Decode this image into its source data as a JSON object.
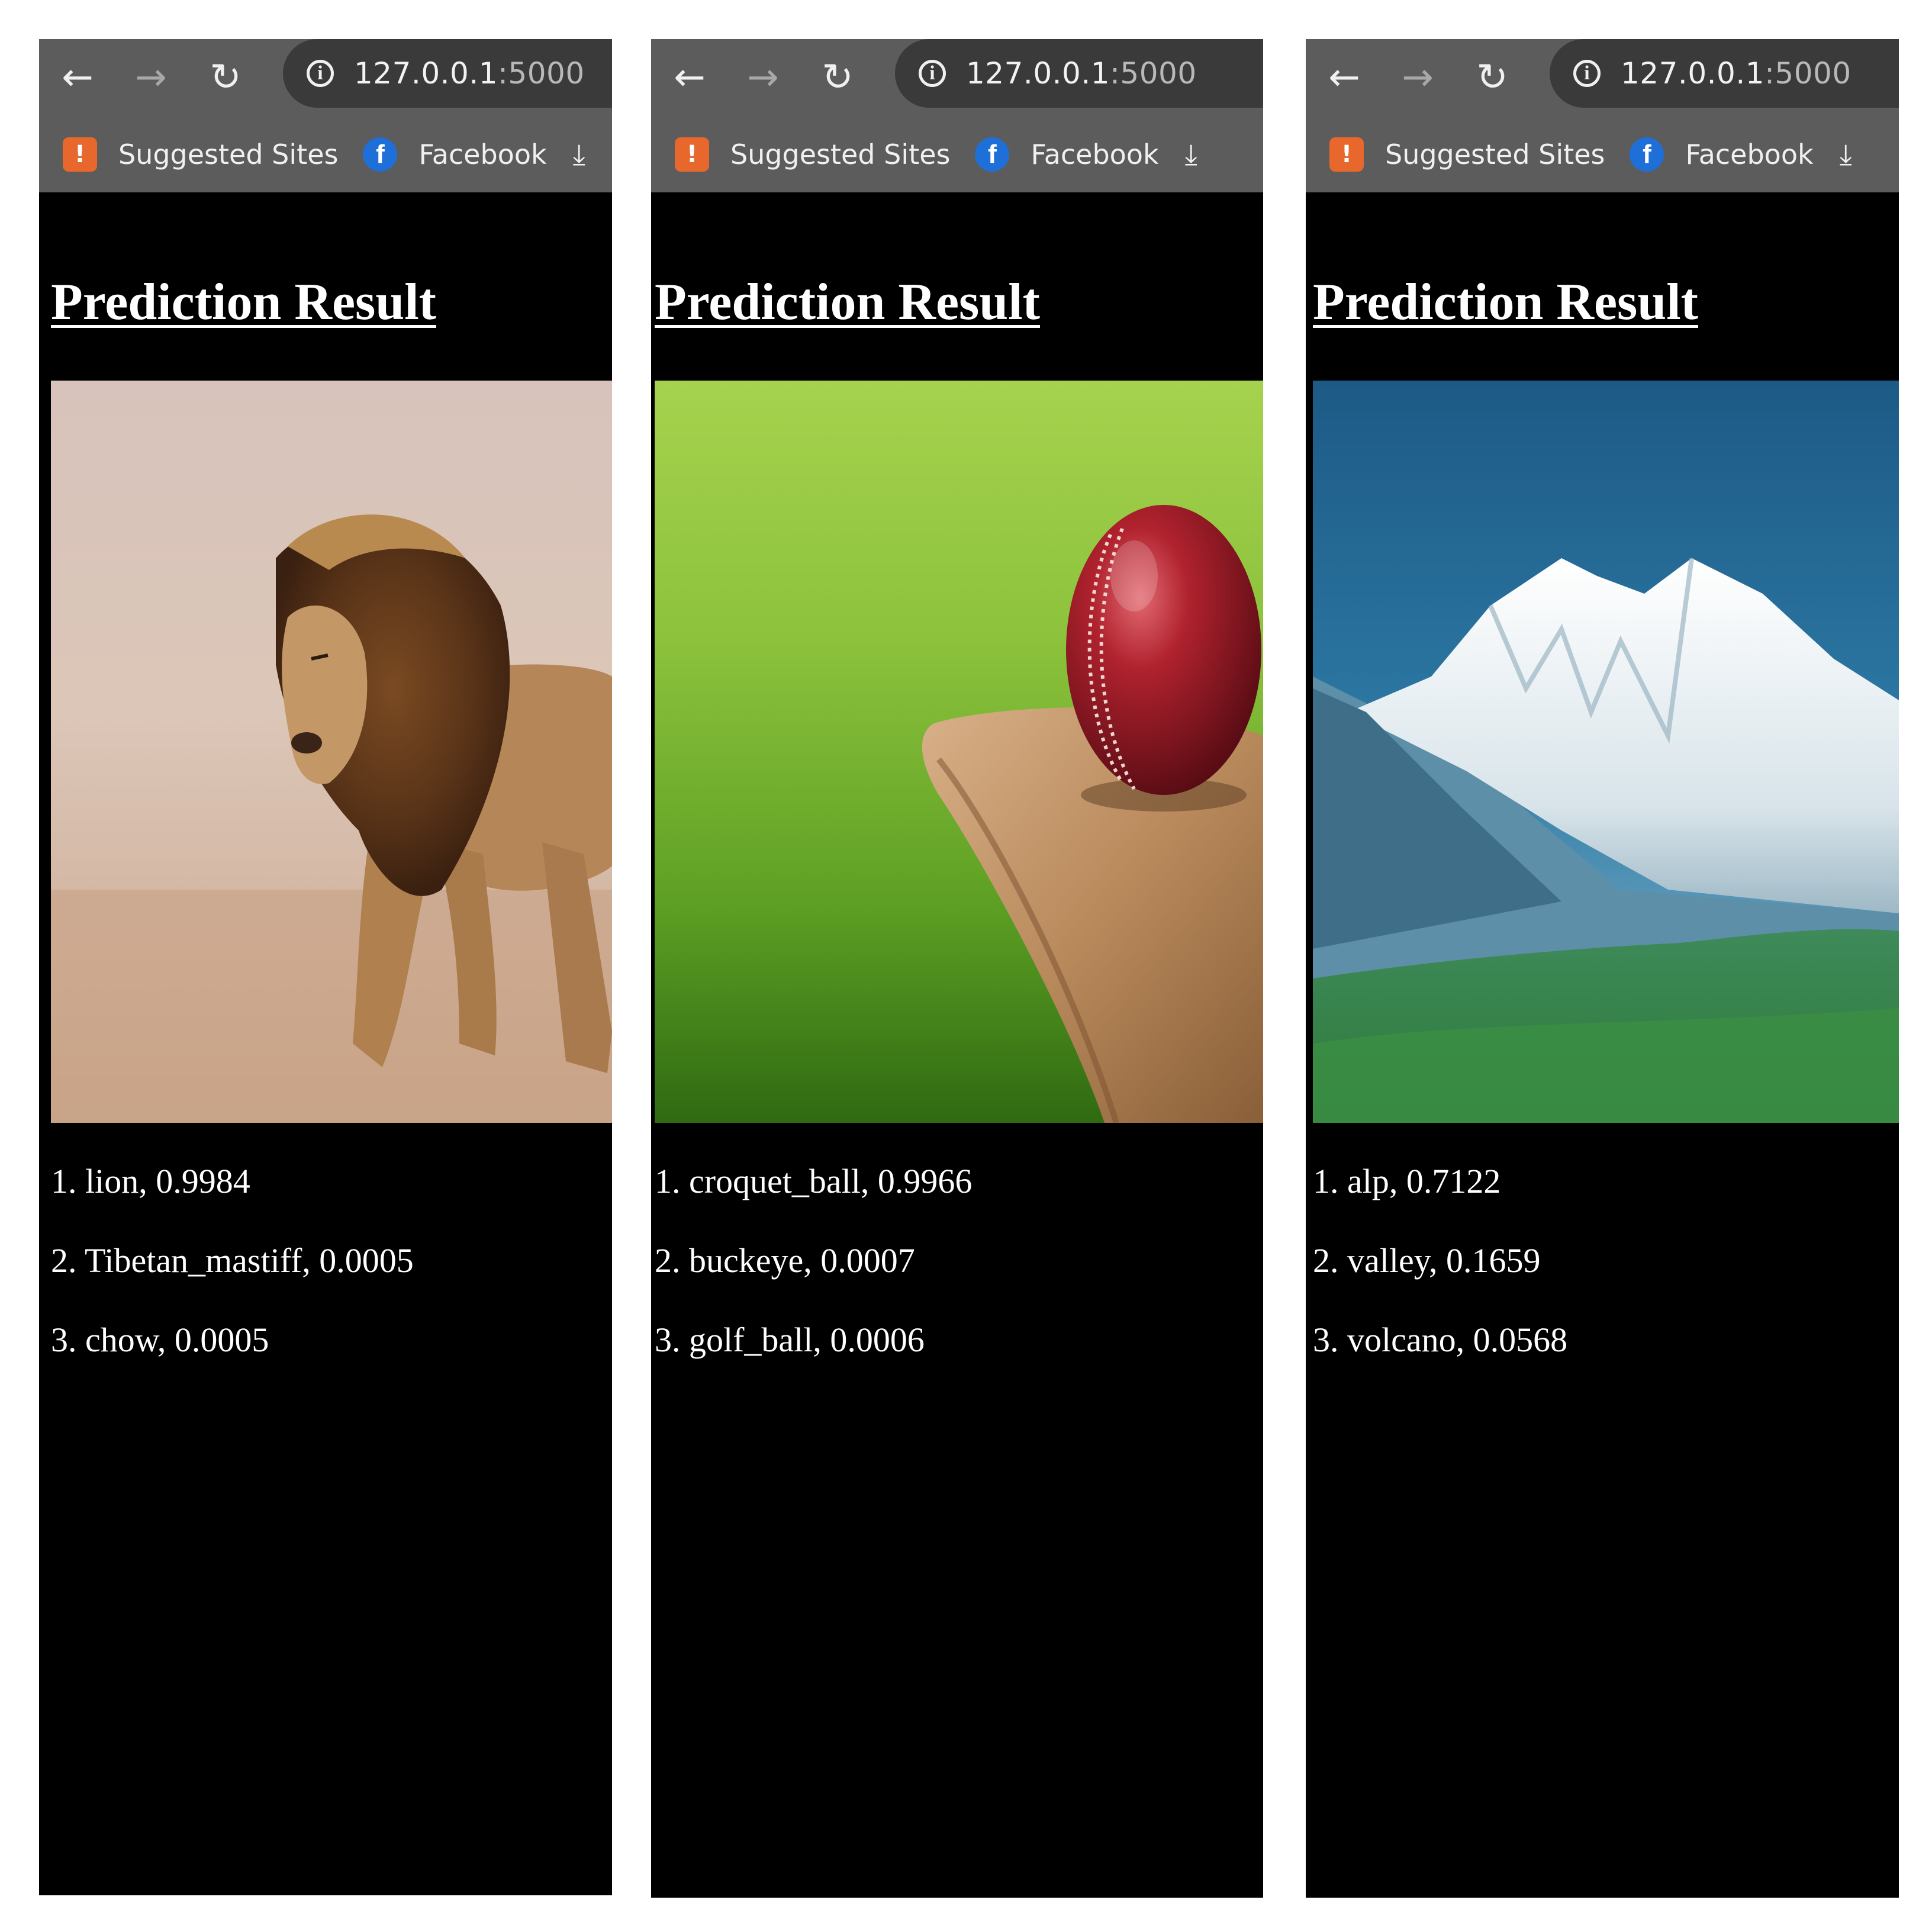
{
  "browser": {
    "url_host": "127.0.0.1",
    "url_port": ":5000",
    "bookmarks": [
      "Suggested Sites",
      "Facebook"
    ]
  },
  "page": {
    "title": "Prediction Result"
  },
  "screens": [
    {
      "image_subject": "lion",
      "predictions": [
        "1. lion, 0.9984",
        "2. Tibetan_mastiff, 0.0005",
        "3. chow, 0.0005"
      ]
    },
    {
      "image_subject": "cricket ball on bat",
      "predictions": [
        "1. croquet_ball, 0.9966",
        "2. buckeye, 0.0007",
        "3. golf_ball, 0.0006"
      ]
    },
    {
      "image_subject": "snowy mountain",
      "predictions": [
        "1. alp, 0.7122",
        "2. valley, 0.1659",
        "3. volcano, 0.0568"
      ]
    }
  ],
  "icons": {
    "back": "back-arrow-icon",
    "forward": "forward-arrow-icon",
    "reload": "reload-icon",
    "info": "info-icon",
    "suggested_sites": "suggested-sites-icon",
    "facebook": "facebook-icon",
    "download": "download-icon"
  }
}
